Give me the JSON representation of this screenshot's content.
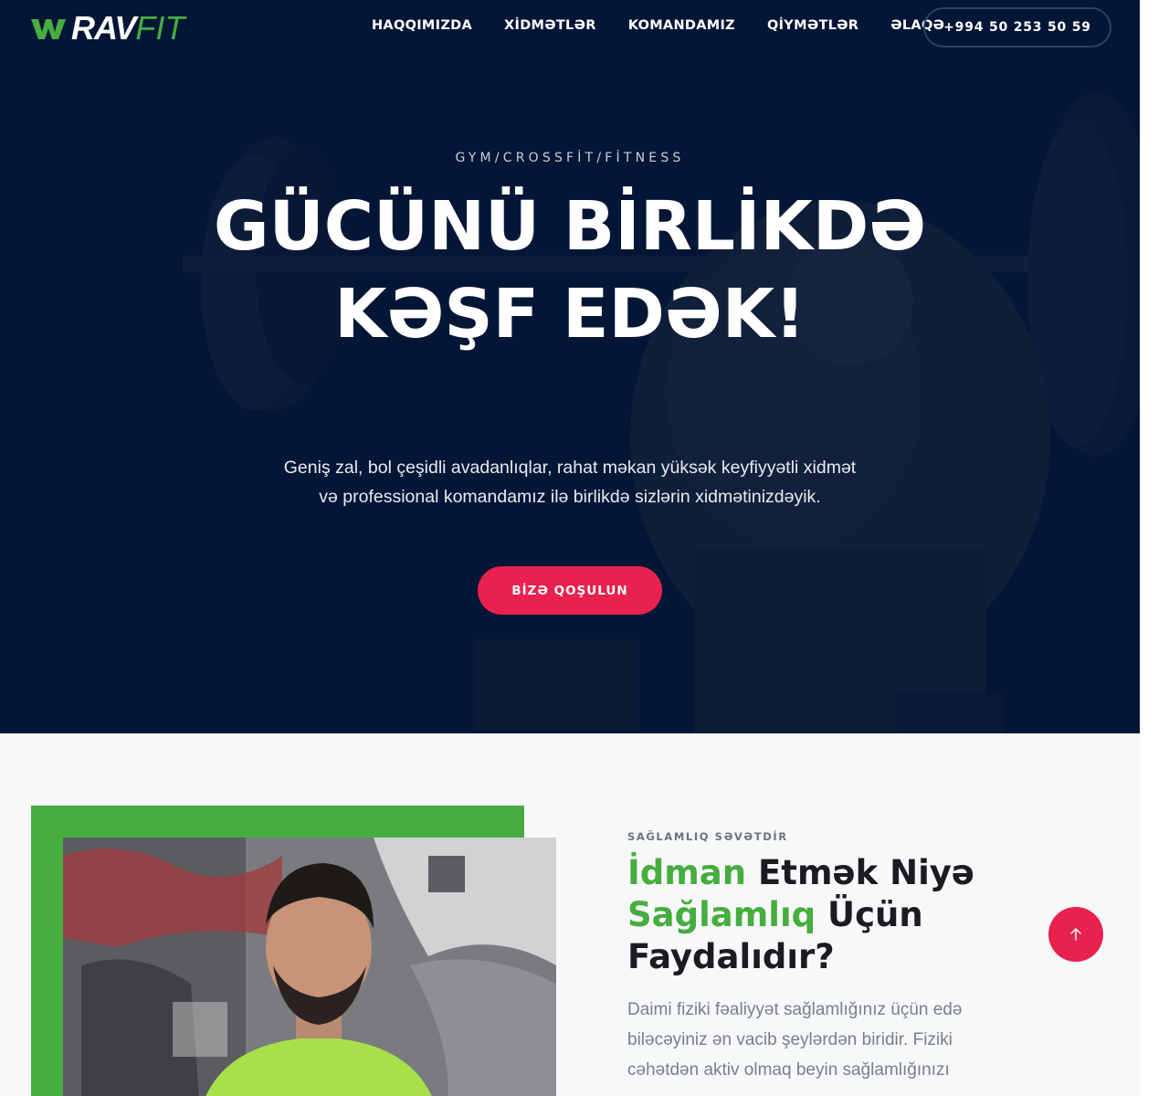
{
  "nav": {
    "logo_rav": "RAV",
    "logo_fit": "FIT",
    "menu": [
      "HAQQIMIZDA",
      "XİDMƏTLƏR",
      "KOMANDAMIZ",
      "QİYMƏTLƏR",
      "ƏLAQƏ"
    ],
    "phone": "+994 50 253 50 59"
  },
  "hero": {
    "subtitle": "GYM/CROSSFİT/FİTNESS",
    "title": "GÜCÜNÜ BİRLİKDƏ KƏŞF EDƏK!",
    "description": "Geniş zal, bol çeşidli avadanlıqlar, rahat məkan yüksək keyfiyyətli xidmət və professional komandamız ilə birlikdə sizlərin xidmətinizdəyik.",
    "cta": "BİZƏ QOŞULUN"
  },
  "about": {
    "eyebrow": "SAĞLAMLIQ SƏVƏTDİR",
    "title_part1": "İdman",
    "title_part2": " Etmək Niyə ",
    "title_part3": "Sağlamlıq",
    "title_part4": " Üçün Faydalıdır?",
    "text": "Daimi fiziki fəaliyyət sağlamlığınız üçün edə biləcəyiniz ən vacib şeylərdən biridir. Fiziki cəhətdən aktiv olmaq beyin sağlamlığınızı"
  },
  "colors": {
    "accent_green": "#46ad3e",
    "accent_red": "#e8214f",
    "hero_navy": "#021536"
  },
  "icons": {
    "scroll_top": "arrow-up-icon",
    "logo": "ravfit-logo-mark-icon"
  }
}
